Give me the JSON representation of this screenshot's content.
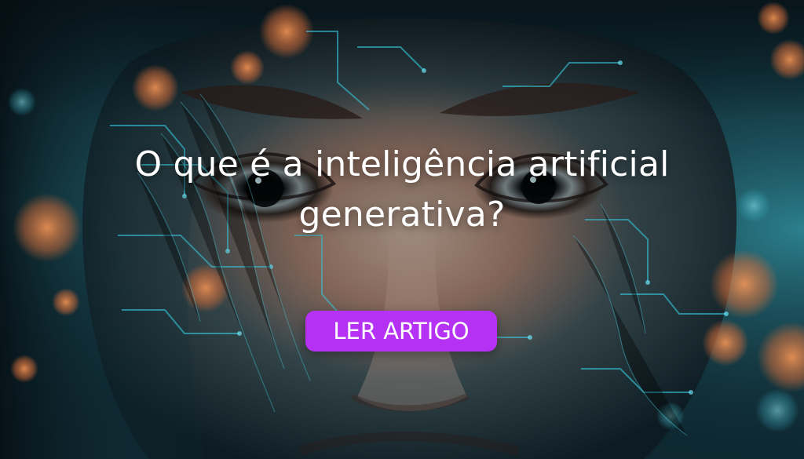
{
  "hero": {
    "headline_line1": "O que é a inteligência artificial",
    "headline_line2": "generativa?",
    "cta_label": "LER ARTIGO",
    "background_icon": "ai-face-portrait-image"
  },
  "colors": {
    "background_base": "#0e2730",
    "cyan_accent": "#38d7f0",
    "bokeh_orange": "#d87a45",
    "cta_background": "#b531f3",
    "text": "#ffffff"
  }
}
